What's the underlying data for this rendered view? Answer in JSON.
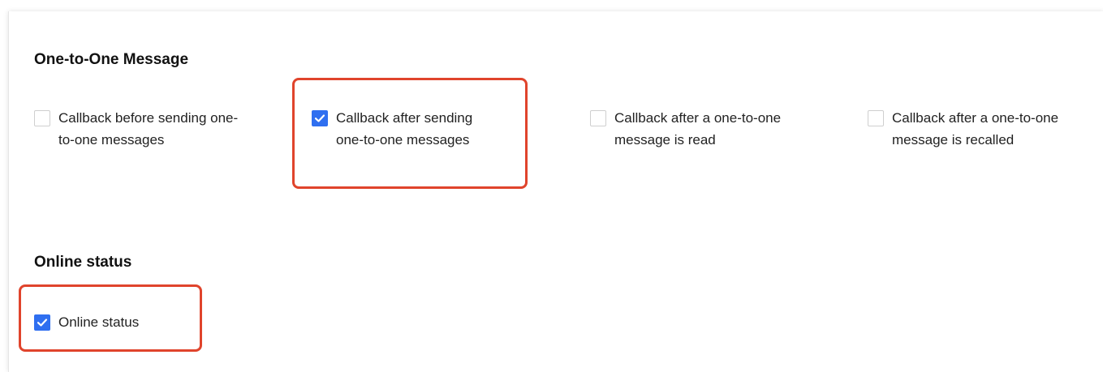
{
  "sections": [
    {
      "title": "One-to-One Message",
      "options": [
        {
          "label": "Callback before sending one-\nto-one messages",
          "checked": false
        },
        {
          "label": "Callback after sending\none-to-one messages",
          "checked": true
        },
        {
          "label": "Callback after a one-to-one\nmessage is read",
          "checked": false
        },
        {
          "label": "Callback after a one-to-one\nmessage is recalled",
          "checked": false
        }
      ]
    },
    {
      "title": "Online status",
      "options": [
        {
          "label": "Online status",
          "checked": true
        }
      ]
    }
  ],
  "colors": {
    "checkbox_checked": "#2f6ff0",
    "highlight_border": "#e0442c"
  },
  "icons": {
    "checkmark": "check-icon"
  }
}
